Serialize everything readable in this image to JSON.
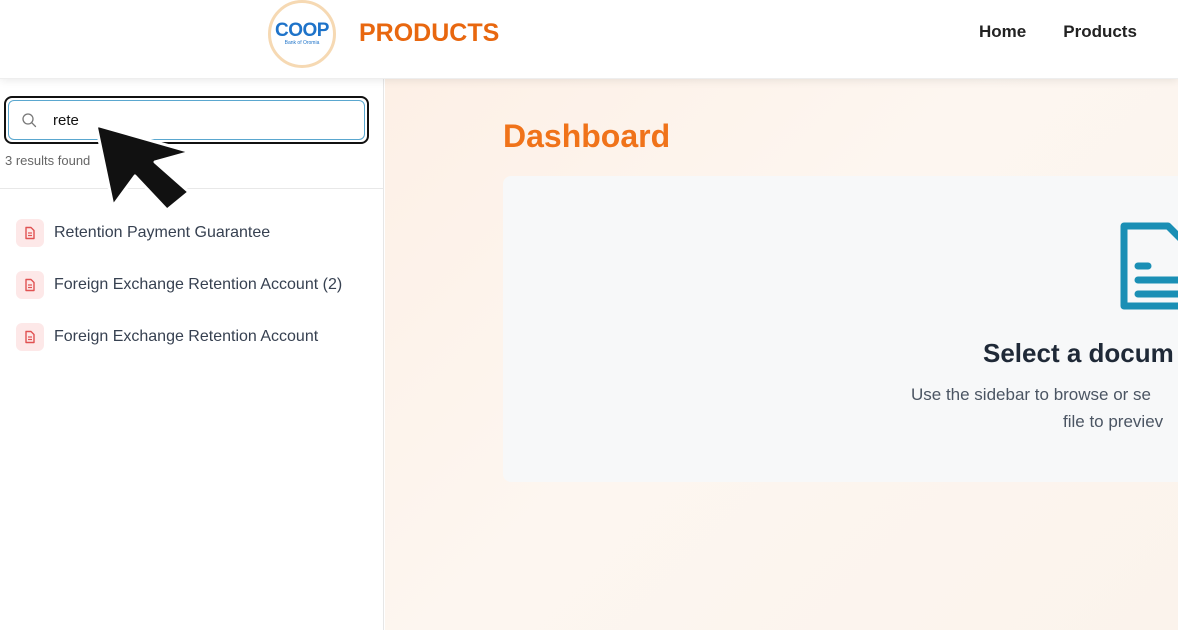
{
  "header": {
    "logo_text": "COOP",
    "logo_subtext": "Bank of Oromia",
    "brand": "PRODUCTS",
    "nav": [
      {
        "label": "Home"
      },
      {
        "label": "Products"
      }
    ]
  },
  "sidebar": {
    "search": {
      "value": "rete",
      "icon": "search-icon"
    },
    "results_count": "3 results found",
    "results": [
      {
        "label": "Retention Payment Guarantee",
        "icon": "document-icon"
      },
      {
        "label": "Foreign Exchange Retention Account (2)",
        "icon": "document-icon"
      },
      {
        "label": "Foreign Exchange Retention Account",
        "icon": "document-icon"
      }
    ]
  },
  "main": {
    "title": "Dashboard",
    "empty_state": {
      "icon": "document-icon",
      "heading": "Select a docum",
      "sub_line1": "Use the sidebar to browse or se",
      "sub_line2": "file to previev"
    }
  },
  "colors": {
    "brand_orange": "#e8670f",
    "title_orange": "#f0731a",
    "doc_teal": "#1a8fb5",
    "doc_red": "#e05252"
  }
}
